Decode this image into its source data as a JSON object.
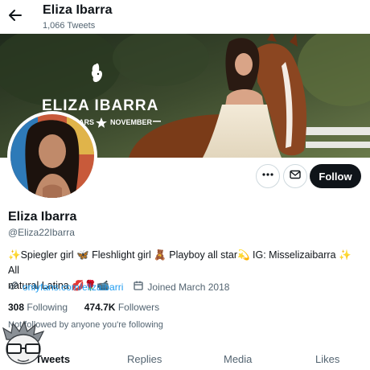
{
  "header": {
    "title": "Eliza Ibarra",
    "tweet_count": "1,066 Tweets"
  },
  "banner": {
    "brand_title": "ELIZA IBARRA",
    "brand_subtitle_left": "ARS",
    "brand_subtitle_right": "NOVEMBER"
  },
  "actions": {
    "follow_label": "Follow"
  },
  "profile": {
    "name": "Eliza Ibarra",
    "handle": "@Eliza22Ibarra",
    "bio_line1": "✨Spiegler girl 🦋 Fleshlight girl 🧸 Playboy all star💫 IG: Misselizaibarra ✨ All",
    "bio_line2": "natural Latina 💋🌹📹",
    "link": "onlyfans.com/elizaibarri",
    "joined": "Joined March 2018",
    "following_count": "308",
    "following_label": "Following",
    "followers_count": "474.7K",
    "followers_label": "Followers",
    "not_followed": "Not followed by anyone you're following"
  },
  "tabs": [
    "Tweets",
    "Replies",
    "Media",
    "Likes"
  ],
  "icons": {
    "back": "arrow-left-icon",
    "more": "more-icon",
    "message": "envelope-icon",
    "link": "link-icon",
    "calendar": "calendar-icon",
    "watermark": "cartoon-face-icon"
  },
  "colors": {
    "accent": "#1d9bf0",
    "text": "#0f1419",
    "muted": "#536471",
    "follow_bg": "#0f1419"
  }
}
